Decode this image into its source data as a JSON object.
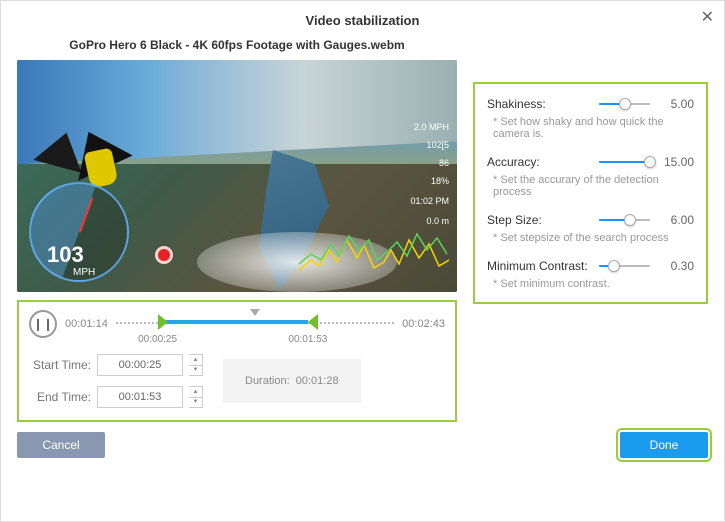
{
  "title": "Video stabilization",
  "video_title": "GoPro Hero 6 Black - 4K 60fps Footage with Gauges.webm",
  "gauge": {
    "speed": "103",
    "unit": "MPH"
  },
  "overlay": {
    "altitude": "2.0 MPH",
    "speed": "102[5",
    "p1": "86",
    "p2": "18%",
    "time": "01:02 PM",
    "date": "0.0 m"
  },
  "timeline": {
    "current": "00:01:14",
    "total": "00:02:43",
    "range_start_label": "00:00:25",
    "range_end_label": "00:01:53",
    "start_pct": 15,
    "end_pct": 69
  },
  "inputs": {
    "start_label": "Start Time:",
    "start_value": "00:00:25",
    "end_label": "End Time:",
    "end_value": "00:01:53",
    "duration_label": "Duration:",
    "duration_value": "00:01:28"
  },
  "settings": [
    {
      "label": "Shakiness:",
      "value": "5.00",
      "pct": 50,
      "desc": "* Set how shaky and how quick the camera is."
    },
    {
      "label": "Accuracy:",
      "value": "15.00",
      "pct": 100,
      "desc": "* Set the accurary of the detection process"
    },
    {
      "label": "Step Size:",
      "value": "6.00",
      "pct": 60,
      "desc": "* Set stepsize of the search process"
    },
    {
      "label": "Minimum Contrast:",
      "value": "0.30",
      "pct": 30,
      "desc": "* Set minimum contrast."
    }
  ],
  "buttons": {
    "cancel": "Cancel",
    "done": "Done"
  }
}
